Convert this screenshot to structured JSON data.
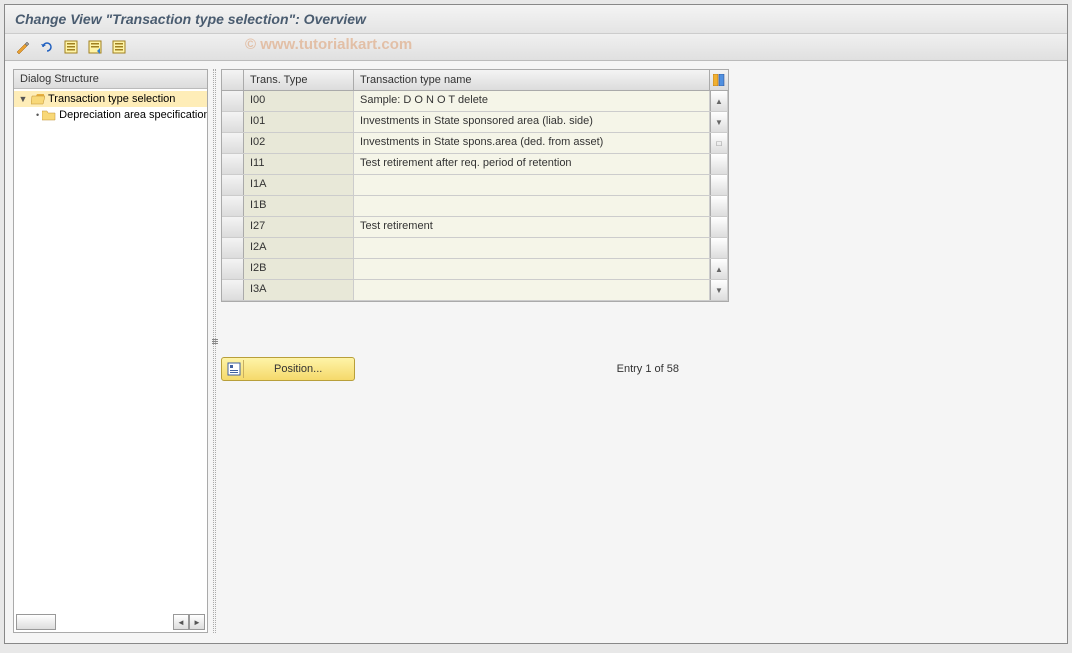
{
  "title": "Change View \"Transaction type selection\": Overview",
  "watermark": "© www.tutorialkart.com",
  "toolbar": {
    "icons": [
      "change",
      "undo",
      "select-all",
      "deselect-all",
      "export"
    ]
  },
  "sidebar": {
    "title": "Dialog Structure",
    "items": [
      {
        "label": "Transaction type selection",
        "selected": true,
        "level": 0
      },
      {
        "label": "Depreciation area specification",
        "selected": false,
        "level": 1
      }
    ]
  },
  "grid": {
    "headers": {
      "type": "Trans. Type",
      "name": "Transaction type name"
    },
    "rows": [
      {
        "type": "I00",
        "name": "Sample:  D O  N O T delete"
      },
      {
        "type": "I01",
        "name": "Investments in State sponsored area (liab. side)"
      },
      {
        "type": "I02",
        "name": "Investments in State spons.area (ded. from asset)"
      },
      {
        "type": "I11",
        "name": "Test retirement after req. period of retention"
      },
      {
        "type": "I1A",
        "name": ""
      },
      {
        "type": "I1B",
        "name": ""
      },
      {
        "type": "I27",
        "name": "Test retirement"
      },
      {
        "type": "I2A",
        "name": ""
      },
      {
        "type": "I2B",
        "name": ""
      },
      {
        "type": "I3A",
        "name": ""
      }
    ]
  },
  "footer": {
    "position": "Position...",
    "entry": "Entry 1 of 58"
  }
}
